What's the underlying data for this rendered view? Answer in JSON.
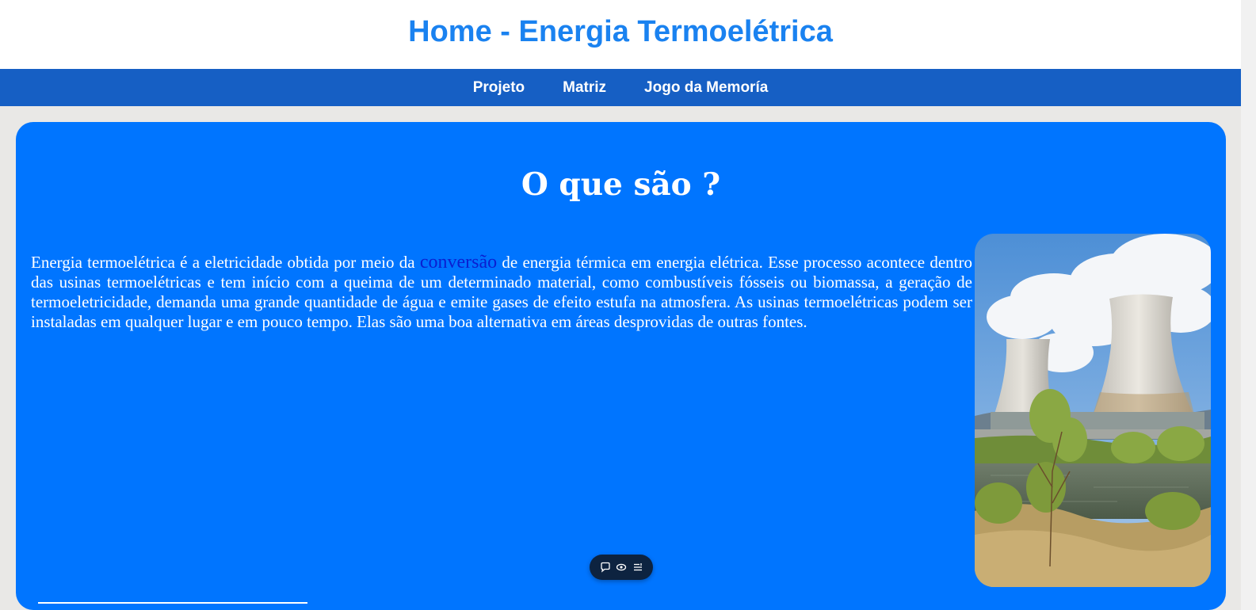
{
  "header": {
    "title": "Home - Energia Termoelétrica"
  },
  "nav": {
    "items": [
      {
        "label": "Projeto"
      },
      {
        "label": "Matriz"
      },
      {
        "label": "Jogo da Memoría"
      }
    ]
  },
  "main": {
    "heading": "O que são ?",
    "paragraph_before": "Energia termoelétrica é a eletricidade obtida por meio da ",
    "highlight_word": "conversão",
    "paragraph_after": " de energia térmica em energia elétrica. Esse processo acontece dentro das usinas termoelétricas e tem início com a queima de um determinado material, como combustíveis fósseis ou biomassa, a geração de termoeletricidade, demanda uma grande quantidade de água e emite gases de efeito estufa na atmosfera. As usinas termoelétricas podem ser instaladas em qualquer lugar e em pouco tempo. Elas são uma boa alternativa em áreas desprovidas de outras fontes."
  },
  "toolbar": {
    "icons": [
      "comment-icon",
      "eye-icon",
      "list-icon"
    ]
  },
  "colors": {
    "header_title": "#1a82f0",
    "navbar": "#165fc4",
    "card": "#0075ff",
    "highlight": "#0a1fd0"
  }
}
